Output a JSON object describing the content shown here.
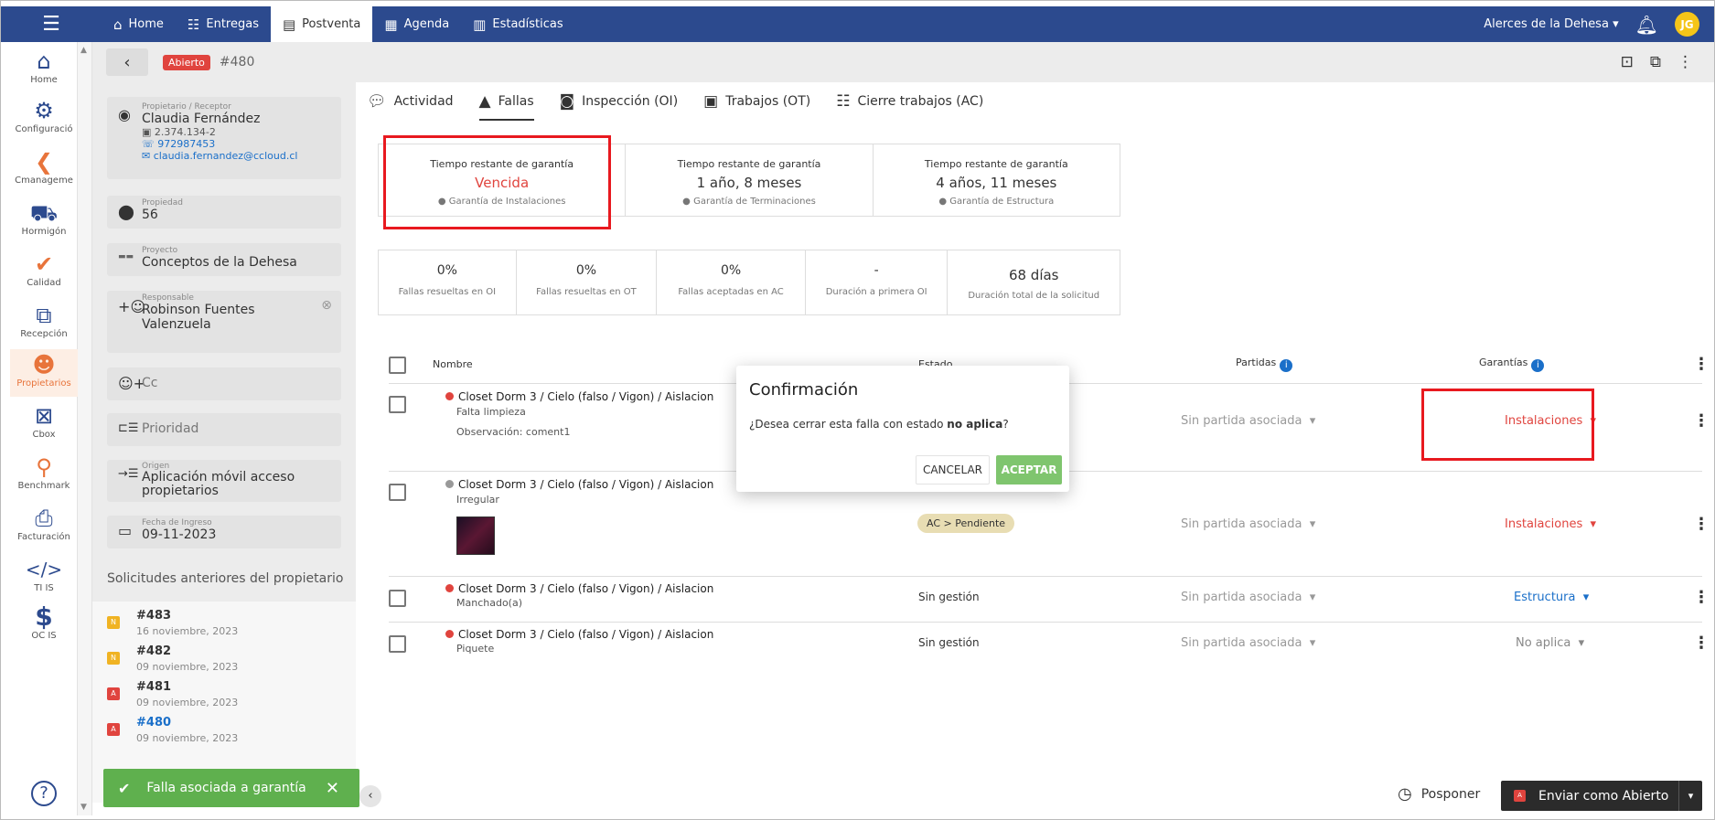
{
  "topnav": {
    "items": [
      {
        "label": "Home",
        "icon": "home-icon"
      },
      {
        "label": "Entregas",
        "icon": "list-icon"
      },
      {
        "label": "Postventa",
        "icon": "document-icon"
      },
      {
        "label": "Agenda",
        "icon": "calendar-icon"
      },
      {
        "label": "Estadísticas",
        "icon": "bar-chart-icon"
      }
    ],
    "active": "Postventa",
    "project_selector": "Alerces de la Dehesa",
    "avatar_initials": "JG"
  },
  "sidebar": {
    "items": [
      {
        "label": "Home",
        "icon": "home-icon"
      },
      {
        "label": "Configuració",
        "icon": "gear-icon"
      },
      {
        "label": "Cmanageme",
        "icon": "cmanagement-icon"
      },
      {
        "label": "Hormigón",
        "icon": "wheelbarrow-icon"
      },
      {
        "label": "Calidad",
        "icon": "check-icon"
      },
      {
        "label": "Recepción",
        "icon": "reception-icon"
      },
      {
        "label": "Propietarios",
        "icon": "owners-icon"
      },
      {
        "label": "Cbox",
        "icon": "cbox-icon"
      },
      {
        "label": "Benchmark",
        "icon": "magnifier-icon"
      },
      {
        "label": "Facturación",
        "icon": "invoice-icon"
      },
      {
        "label": "TI IS",
        "icon": "code-icon"
      },
      {
        "label": "OC IS",
        "icon": "dollar-icon"
      }
    ],
    "active": "Propietarios"
  },
  "header": {
    "status_badge": "Abierto",
    "ticket_id": "#480"
  },
  "detail": {
    "owner_small": "Propietario / Receptor",
    "owner_name": "Claudia Fernández",
    "owner_rut": "2.374.134-2",
    "owner_phone": "972987453",
    "owner_email": "claudia.fernandez@ccloud.cl",
    "property_small": "Propiedad",
    "property_value": "56",
    "project_small": "Proyecto",
    "project_value": "Conceptos de la Dehesa",
    "responsible_small": "Responsable",
    "responsible_value": "Robinson Fuentes Valenzuela",
    "cc_label": "Cc",
    "priority_label": "Prioridad",
    "origin_small": "Origen",
    "origin_value": "Aplicación móvil acceso propietarios",
    "date_small": "Fecha de Ingreso",
    "date_value": "09-11-2023",
    "previous_title": "Solicitudes anteriores del propietario",
    "previous": [
      {
        "badge": "N",
        "number": "#483",
        "date": "16 noviembre, 2023",
        "color": "#f0b323"
      },
      {
        "badge": "N",
        "number": "#482",
        "date": "09 noviembre, 2023",
        "color": "#f0b323"
      },
      {
        "badge": "A",
        "number": "#481",
        "date": "09 noviembre, 2023",
        "color": "#e0443e"
      },
      {
        "badge": "A",
        "number": "#480",
        "date": "09 noviembre, 2023",
        "color": "#e0443e"
      }
    ]
  },
  "tabs": [
    {
      "label": "Actividad",
      "icon": "chat-icon"
    },
    {
      "label": "Fallas",
      "icon": "warning-icon"
    },
    {
      "label": "Inspección (OI)",
      "icon": "inspection-icon"
    },
    {
      "label": "Trabajos (OT)",
      "icon": "briefcase-icon"
    },
    {
      "label": "Cierre trabajos (AC)",
      "icon": "checklist-icon"
    }
  ],
  "active_tab": "Fallas",
  "guarantees": [
    {
      "label": "Tiempo restante de garantía",
      "value": "Vencida",
      "sub": "Garantía de Instalaciones"
    },
    {
      "label": "Tiempo restante de garantía",
      "value": "1 año, 8 meses",
      "sub": "Garantía de Terminaciones"
    },
    {
      "label": "Tiempo restante de garantía",
      "value": "4 años, 11 meses",
      "sub": "Garantía de Estructura"
    }
  ],
  "stats": [
    {
      "value": "0%",
      "label": "Fallas resueltas en OI"
    },
    {
      "value": "0%",
      "label": "Fallas resueltas en OT"
    },
    {
      "value": "0%",
      "label": "Fallas aceptadas en AC"
    },
    {
      "value": "-",
      "label": "Duración a primera OI"
    },
    {
      "value": "68 días",
      "label": "Duración total de la solicitud"
    }
  ],
  "table": {
    "headers": {
      "name": "Nombre",
      "status": "Estado",
      "items": "Partidas",
      "guarantees": "Garantías"
    },
    "rows": [
      {
        "title": "Closet Dorm 3 / Cielo (falso / Vigon) / Aislacion",
        "sub1": "Falta limpieza",
        "sub2": "Observación: coment1",
        "status": "",
        "partida": "Sin partida asociada",
        "garantia": "Instalaciones",
        "dot_color": "#e0443e"
      },
      {
        "title": "Closet Dorm 3 / Cielo (falso / Vigon) / Aislacion",
        "sub1": "Irregular",
        "sub2": "",
        "status": "AC > Pendiente",
        "partida": "Sin partida asociada",
        "garantia": "Instalaciones",
        "dot_color": "#999999"
      },
      {
        "title": "Closet Dorm 3 / Cielo (falso / Vigon) / Aislacion",
        "sub1": "Manchado(a)",
        "sub2": "",
        "status": "Sin gestión",
        "partida": "Sin partida asociada",
        "garantia": "Estructura",
        "dot_color": "#e0443e"
      },
      {
        "title": "Closet Dorm 3 / Cielo (falso / Vigon) / Aislacion",
        "sub1": "Piquete",
        "sub2": "",
        "status": "Sin gestión",
        "partida": "Sin partida asociada",
        "garantia": "No aplica",
        "dot_color": "#e0443e"
      }
    ]
  },
  "modal": {
    "title": "Confirmación",
    "question_prefix": "¿Desea cerrar esta falla con estado ",
    "question_bold": "no aplica",
    "question_suffix": "?",
    "cancel_label": "CANCELAR",
    "accept_label": "ACEPTAR"
  },
  "footer": {
    "postpone_label": "Posponer",
    "send_badge": "A",
    "send_label": "Enviar como Abierto"
  },
  "toast": {
    "message": "Falla asociada a garantía"
  },
  "colors": {
    "primary": "#2c4a8e",
    "danger": "#e0443e",
    "success": "#5fb04e",
    "link": "#1a6fc9",
    "highlight": "#e8191f"
  }
}
